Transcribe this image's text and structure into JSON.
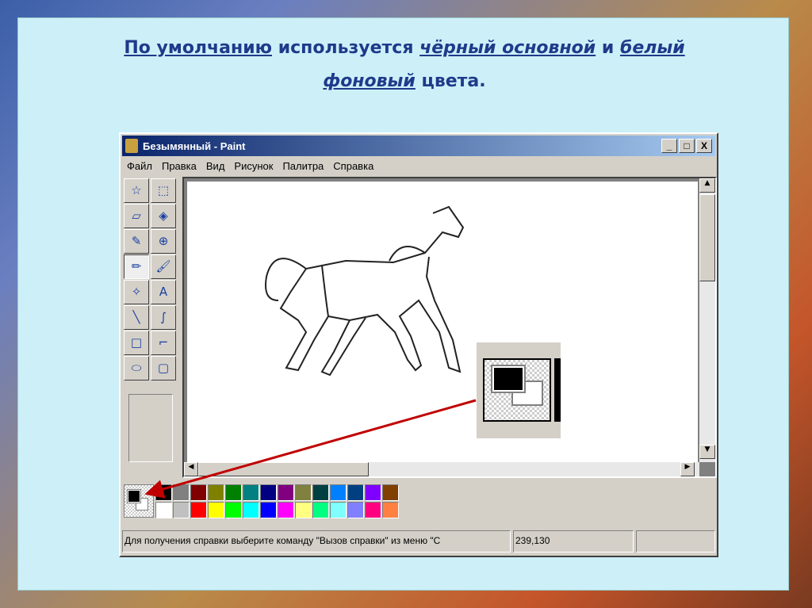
{
  "slide": {
    "title_parts": [
      "По умолчанию",
      "используется",
      "чёрный основной",
      "и",
      "белый",
      "фоновый",
      "цвета."
    ]
  },
  "window": {
    "title": "Безымянный - Paint",
    "min": "_",
    "max": "□",
    "close": "X"
  },
  "menu": [
    "Файл",
    "Правка",
    "Вид",
    "Рисунок",
    "Палитра",
    "Справка"
  ],
  "tools": [
    {
      "name": "free-select",
      "glyph": "☆"
    },
    {
      "name": "rect-select",
      "glyph": "⬚"
    },
    {
      "name": "eraser",
      "glyph": "▱"
    },
    {
      "name": "fill",
      "glyph": "◈"
    },
    {
      "name": "color-picker",
      "glyph": "✎"
    },
    {
      "name": "magnifier",
      "glyph": "⊕"
    },
    {
      "name": "pencil",
      "glyph": "✏"
    },
    {
      "name": "brush",
      "glyph": "🖌"
    },
    {
      "name": "airbrush",
      "glyph": "✧"
    },
    {
      "name": "text",
      "glyph": "A"
    },
    {
      "name": "line",
      "glyph": "╲"
    },
    {
      "name": "curve",
      "glyph": "∫"
    },
    {
      "name": "rectangle",
      "glyph": "□"
    },
    {
      "name": "polygon",
      "glyph": "⌐"
    },
    {
      "name": "ellipse",
      "glyph": "⬭"
    },
    {
      "name": "rounded-rect",
      "glyph": "▢"
    }
  ],
  "palette": {
    "primary": "#000000",
    "secondary": "#ffffff",
    "colors": [
      "#000000",
      "#808080",
      "#800000",
      "#808000",
      "#008000",
      "#008080",
      "#000080",
      "#800080",
      "#808040",
      "#004040",
      "#0080ff",
      "#004080",
      "#8000ff",
      "#804000",
      "#ffffff",
      "#c0c0c0",
      "#ff0000",
      "#ffff00",
      "#00ff00",
      "#00ffff",
      "#0000ff",
      "#ff00ff",
      "#ffff80",
      "#00ff80",
      "#80ffff",
      "#8080ff",
      "#ff0080",
      "#ff8040"
    ]
  },
  "status": {
    "help": "Для получения справки выберите команду \"Вызов справки\" из меню \"С",
    "coords": "239,130"
  }
}
